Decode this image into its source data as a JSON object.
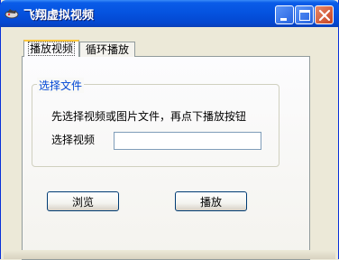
{
  "window": {
    "title": "飞翔虚拟视频"
  },
  "tabs": [
    {
      "label": "播放视频",
      "active": true
    },
    {
      "label": "循环播放",
      "active": false
    }
  ],
  "group": {
    "title": "选择文件",
    "instruction": "先选择视频或图片文件，再点下播放按钮",
    "field_label": "选择视频",
    "field_value": ""
  },
  "buttons": {
    "browse": "浏览",
    "play": "播放"
  },
  "icons": {
    "app": "app-icon",
    "minimize": "minimize-icon",
    "maximize": "maximize-icon",
    "close": "close-icon"
  },
  "colors": {
    "titlebar": "#0553e0",
    "legend": "#0046d5",
    "tab_highlight": "#ffc73c",
    "close": "#c64220"
  }
}
